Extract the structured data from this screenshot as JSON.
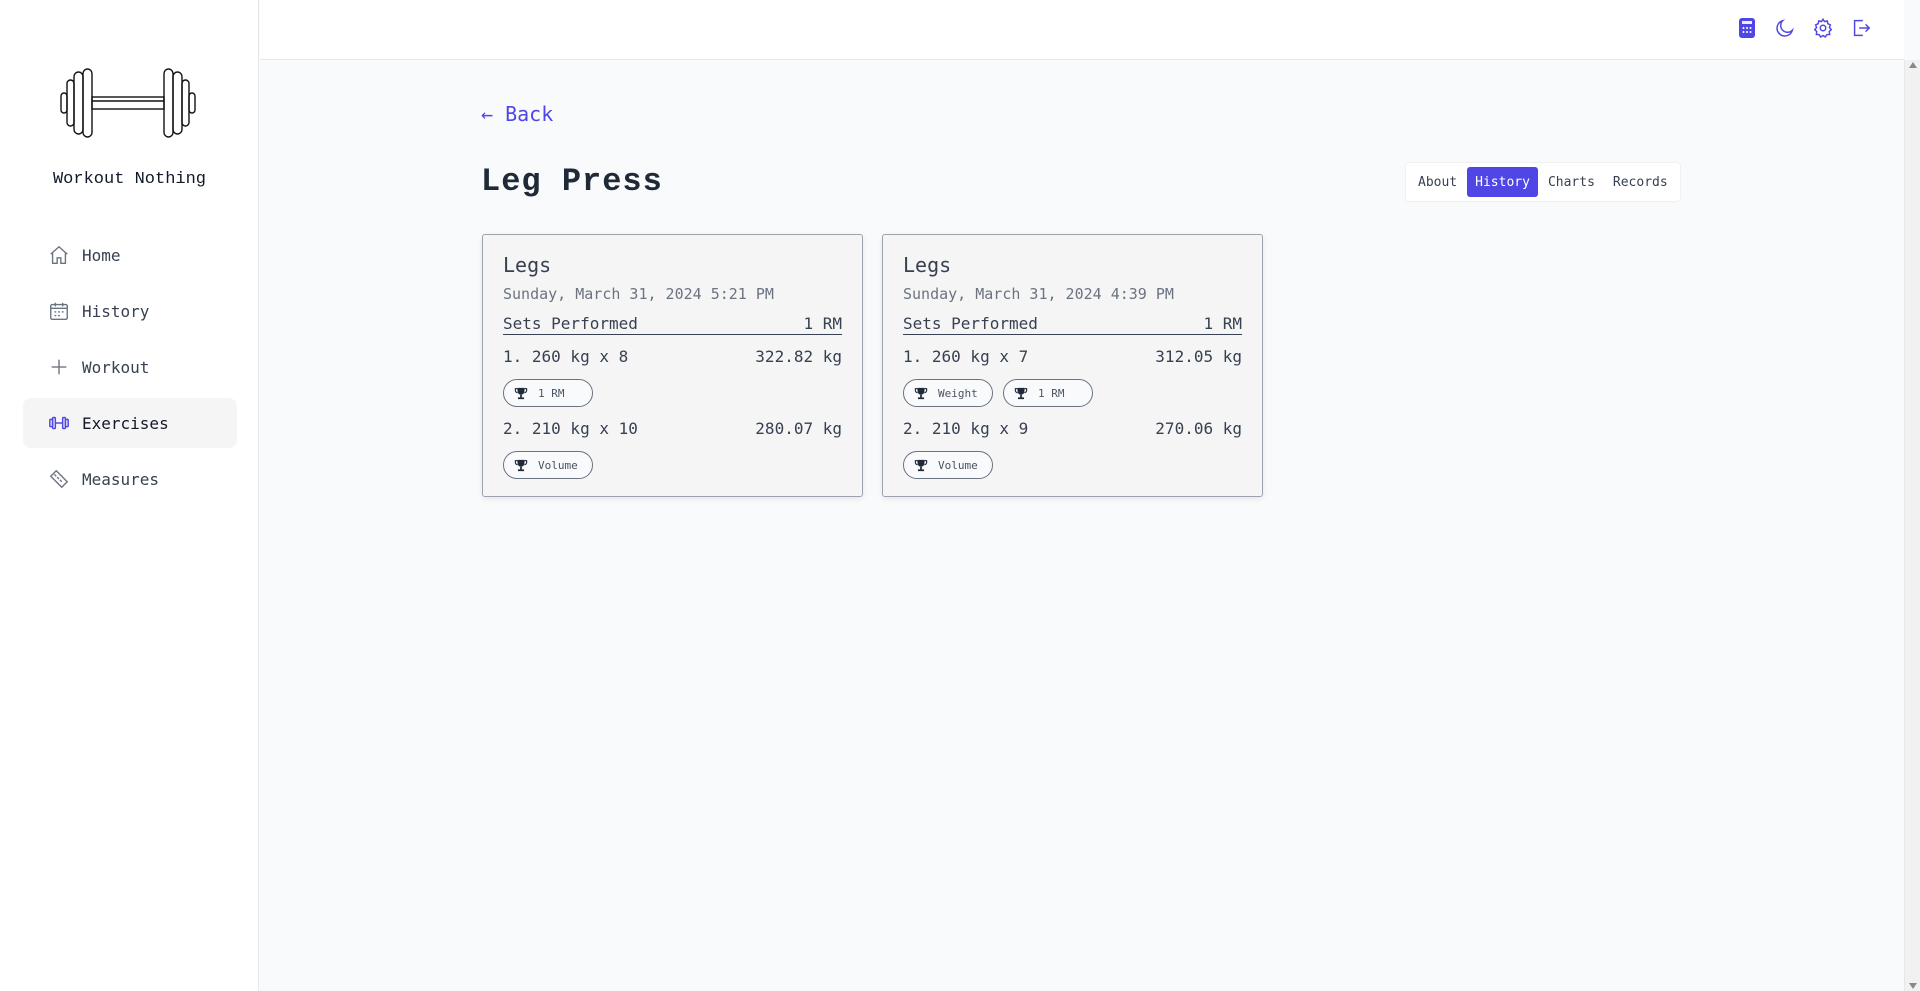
{
  "sidebar": {
    "brand": "Workout Nothing",
    "items": [
      {
        "label": "Home",
        "icon": "home-icon"
      },
      {
        "label": "History",
        "icon": "calendar-icon"
      },
      {
        "label": "Workout",
        "icon": "plus-icon"
      },
      {
        "label": "Exercises",
        "icon": "dumbbell-icon",
        "active": true
      },
      {
        "label": "Measures",
        "icon": "ruler-icon"
      }
    ]
  },
  "topbar": {
    "icons": [
      "calculator-icon",
      "moon-icon",
      "gear-icon",
      "logout-icon"
    ]
  },
  "main": {
    "back_label": "← Back",
    "title": "Leg Press",
    "tabs": [
      {
        "label": "About"
      },
      {
        "label": "History",
        "active": true
      },
      {
        "label": "Charts"
      },
      {
        "label": "Records"
      }
    ],
    "cards": [
      {
        "title": "Legs",
        "date": "Sunday, March 31, 2024 5:21 PM",
        "sets_header": "Sets Performed",
        "rm_header": "1 RM",
        "sets": [
          {
            "label": "1. 260 kg x 8",
            "rm": "322.82 kg",
            "badges": [
              "1 RM"
            ]
          },
          {
            "label": "2. 210 kg x 10",
            "rm": "280.07 kg",
            "badges": [
              "Volume"
            ]
          }
        ]
      },
      {
        "title": "Legs",
        "date": "Sunday, March 31, 2024 4:39 PM",
        "sets_header": "Sets Performed",
        "rm_header": "1 RM",
        "sets": [
          {
            "label": "1. 260 kg x 7",
            "rm": "312.05 kg",
            "badges": [
              "Weight",
              "1 RM"
            ]
          },
          {
            "label": "2. 210 kg x 9",
            "rm": "270.06 kg",
            "badges": [
              "Volume"
            ]
          }
        ]
      }
    ]
  },
  "colors": {
    "accent": "#4f46e5",
    "text": "#374151",
    "muted": "#6b7280",
    "background": "#f9fafb"
  }
}
